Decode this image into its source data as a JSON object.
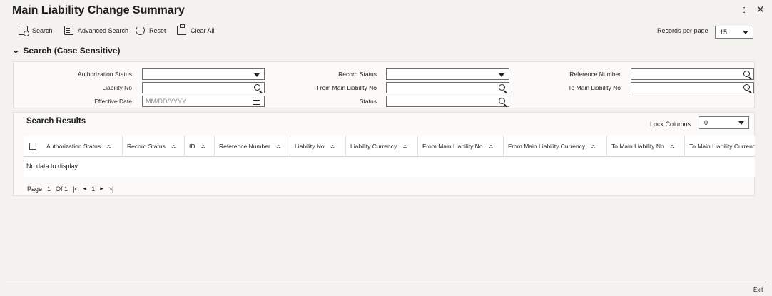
{
  "window": {
    "title": "Main Liability Change Summary"
  },
  "toolbar": {
    "search_label": "Search",
    "advanced_search_label": "Advanced Search",
    "reset_label": "Reset",
    "clear_all_label": "Clear All",
    "records_per_page_label": "Records per page",
    "records_per_page_value": "15"
  },
  "search_section": {
    "heading": "Search (Case Sensitive)",
    "fields": {
      "authorization_status": {
        "label": "Authorization Status",
        "value": ""
      },
      "record_status": {
        "label": "Record Status",
        "value": ""
      },
      "reference_number": {
        "label": "Reference Number",
        "value": ""
      },
      "liability_no": {
        "label": "Liability No",
        "value": ""
      },
      "from_main_liability_no": {
        "label": "From Main Liability No",
        "value": ""
      },
      "to_main_liability_no": {
        "label": "To Main Liability No",
        "value": ""
      },
      "effective_date": {
        "label": "Effective Date",
        "placeholder": "MM/DD/YYYY"
      },
      "status": {
        "label": "Status",
        "value": ""
      }
    }
  },
  "results": {
    "heading": "Search Results",
    "lock_columns_label": "Lock Columns",
    "lock_columns_value": "0",
    "columns": [
      "Authorization Status",
      "Record Status",
      "ID",
      "Reference Number",
      "Liability No",
      "Liability Currency",
      "From Main Liability No",
      "From Main Liability Currency",
      "To Main Liability No",
      "To Main Liability Currency"
    ],
    "sort_glyph": "≎",
    "empty_message": "No data to display."
  },
  "pager": {
    "page_label": "Page",
    "page_value": "1",
    "of_label": "Of 1",
    "first": "|<",
    "prev": "◂",
    "current": "1",
    "next": "▸",
    "last": ">|"
  },
  "footer": {
    "exit_label": "Exit"
  },
  "icons": {
    "close": "close-icon",
    "resize": "resize-icon",
    "search": "search-icon",
    "advanced_search": "advanced-search-icon",
    "reset": "reset-icon",
    "clear": "clear-all-icon",
    "lookup": "magnifier-icon",
    "calendar": "calendar-icon"
  }
}
